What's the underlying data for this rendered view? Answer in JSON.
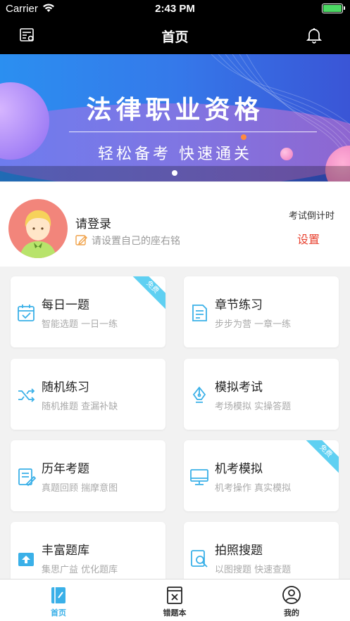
{
  "status_bar": {
    "carrier": "Carrier",
    "time": "2:43 PM"
  },
  "nav": {
    "title": "首页"
  },
  "banner": {
    "title": "法律职业资格",
    "subtitle": "轻松备考 快速通关"
  },
  "profile": {
    "login_text": "请登录",
    "motto_placeholder": "请设置自己的座右铭",
    "countdown_label": "考试倒计时",
    "countdown_action": "设置"
  },
  "cards": [
    {
      "name": "每日一题",
      "desc": "智能选题 一日一练",
      "icon": "calendar-icon",
      "badge": "免费"
    },
    {
      "name": "章节练习",
      "desc": "步步为营 一章一练",
      "icon": "document-icon",
      "badge": ""
    },
    {
      "name": "随机练习",
      "desc": "随机推题 查漏补缺",
      "icon": "shuffle-icon",
      "badge": ""
    },
    {
      "name": "模拟考试",
      "desc": "考场模拟 实操答题",
      "icon": "pen-nib-icon",
      "badge": ""
    },
    {
      "name": "历年考题",
      "desc": "真题回顾 揣摩意图",
      "icon": "exam-paper-icon",
      "badge": ""
    },
    {
      "name": "机考模拟",
      "desc": "机考操作 真实模拟",
      "icon": "monitor-icon",
      "badge": "免费"
    },
    {
      "name": "丰富题库",
      "desc": "集思广益 优化题库",
      "icon": "upload-box-icon",
      "badge": ""
    },
    {
      "name": "拍照搜题",
      "desc": "以图搜题 快速查题",
      "icon": "photo-search-icon",
      "badge": ""
    }
  ],
  "tabbar": [
    {
      "label": "首页",
      "icon": "home-notebook-icon",
      "active": true
    },
    {
      "label": "错题本",
      "icon": "wrong-book-icon",
      "active": false
    },
    {
      "label": "我的",
      "icon": "user-circle-icon",
      "active": false
    }
  ],
  "colors": {
    "accent": "#3ab0e8",
    "warning": "#e8412f",
    "badge": "#5fd0f2"
  }
}
